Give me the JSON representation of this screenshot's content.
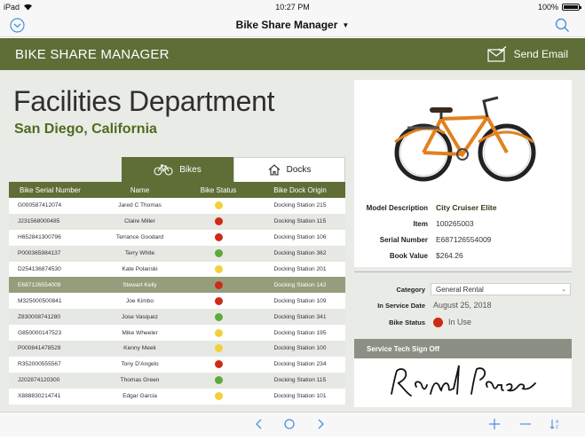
{
  "status_bar": {
    "device": "iPad",
    "time": "10:27 PM",
    "battery": "100%"
  },
  "nav": {
    "title": "Bike Share Manager",
    "caret": "▼"
  },
  "header": {
    "app_title": "BIKE SHARE MANAGER",
    "send_email_label": "Send Email"
  },
  "page": {
    "department": "Facilities Department",
    "location": "San Diego, California"
  },
  "tabs": [
    {
      "label": "Bikes",
      "icon": "bike-icon"
    },
    {
      "label": "Docks",
      "icon": "home-icon"
    }
  ],
  "table": {
    "columns": [
      "Bike Serial Number",
      "Name",
      "Bike Status",
      "Bike Dock Origin"
    ],
    "rows": [
      {
        "serial": "G000587412074",
        "name": "Jared C Thomas",
        "status": "yellow",
        "dock": "Docking Station 215"
      },
      {
        "serial": "J231568000485",
        "name": "Claire Miller",
        "status": "red",
        "dock": "Docking Station 115"
      },
      {
        "serial": "H652841300796",
        "name": "Terrance Goodard",
        "status": "red",
        "dock": "Docking Station 106"
      },
      {
        "serial": "P000365984137",
        "name": "Terry White",
        "status": "green",
        "dock": "Docking Station 362"
      },
      {
        "serial": "D254136874530",
        "name": "Kate Polanski",
        "status": "yellow",
        "dock": "Docking Station 201"
      },
      {
        "serial": "E687126554009",
        "name": "Stewart Kelly",
        "status": "red",
        "dock": "Docking Station 142"
      },
      {
        "serial": "M325000500841",
        "name": "Joe Kimbo",
        "status": "red",
        "dock": "Docking Station 109"
      },
      {
        "serial": "Z830008741280",
        "name": "Jose Vasquez",
        "status": "green",
        "dock": "Docking Station 341"
      },
      {
        "serial": "G850000147523",
        "name": "Mike Wheeler",
        "status": "yellow",
        "dock": "Docking Station 195"
      },
      {
        "serial": "P000841478529",
        "name": "Kenny Meek",
        "status": "yellow",
        "dock": "Docking Station 100"
      },
      {
        "serial": "R352000555567",
        "name": "Tony D'Angelo",
        "status": "red",
        "dock": "Docking Station 234"
      },
      {
        "serial": "J202874120300",
        "name": "Thomas Green",
        "status": "green",
        "dock": "Docking Station 115"
      },
      {
        "serial": "X888830214741",
        "name": "Edgar Garcia",
        "status": "yellow",
        "dock": "Docking Station 101"
      }
    ],
    "selected_row": 5
  },
  "details": {
    "model_label": "Model Description",
    "model_value": "City Cruiser Elite",
    "item_label": "Item",
    "item_value": "100265003",
    "serial_label": "Serial Number",
    "serial_value": "E687126554009",
    "book_label": "Book Value",
    "book_value": "$264.26"
  },
  "service": {
    "category_label": "Category",
    "category_value": "General Rental",
    "date_label": "In Service Date",
    "date_value": "August 25, 2018",
    "status_label": "Bike Status",
    "status_value": "In Use"
  },
  "signoff": {
    "title": "Service Tech Sign Off",
    "signature": "Rand Parsons"
  },
  "colors": {
    "accent": "#5f6d36",
    "status_red": "#cf2a17",
    "status_yellow": "#f2d03a",
    "status_green": "#5cab3c",
    "ios_blue": "#4a90e2"
  }
}
